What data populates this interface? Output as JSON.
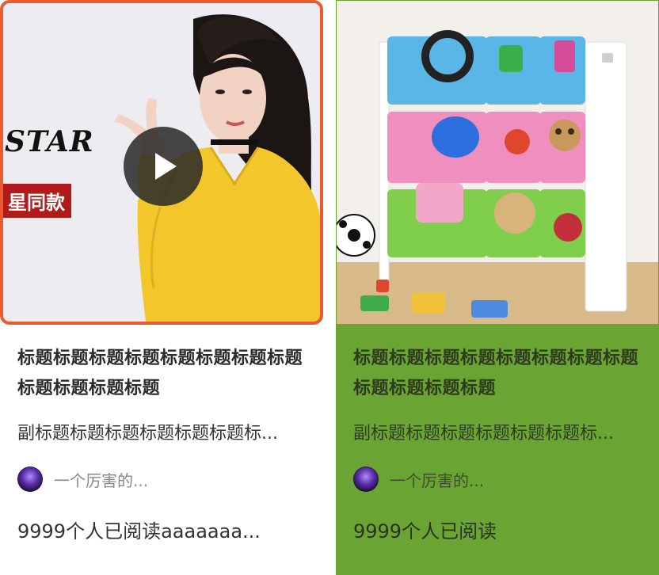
{
  "cards": [
    {
      "title": "标题标题标题标题标题标题标题标题标题标题标题标题",
      "subtitle": "副标题标题标题标题标题标题标...",
      "author": "一个厉害的...",
      "reads": "9999个人已阅读aaaaaaa...",
      "media": {
        "overlay_star_text": "STAR",
        "overlay_tag_text": "星同款",
        "play_icon": "play-icon"
      },
      "highlight_border_color": "#ea5a2e"
    },
    {
      "title": "标题标题标题标题标题标题标题标题标题标题标题标题",
      "subtitle": "副标题标题标题标题标题标题标...",
      "author": "一个厉害的...",
      "reads": "9999个人已阅读",
      "background_color": "#6aa533"
    }
  ]
}
